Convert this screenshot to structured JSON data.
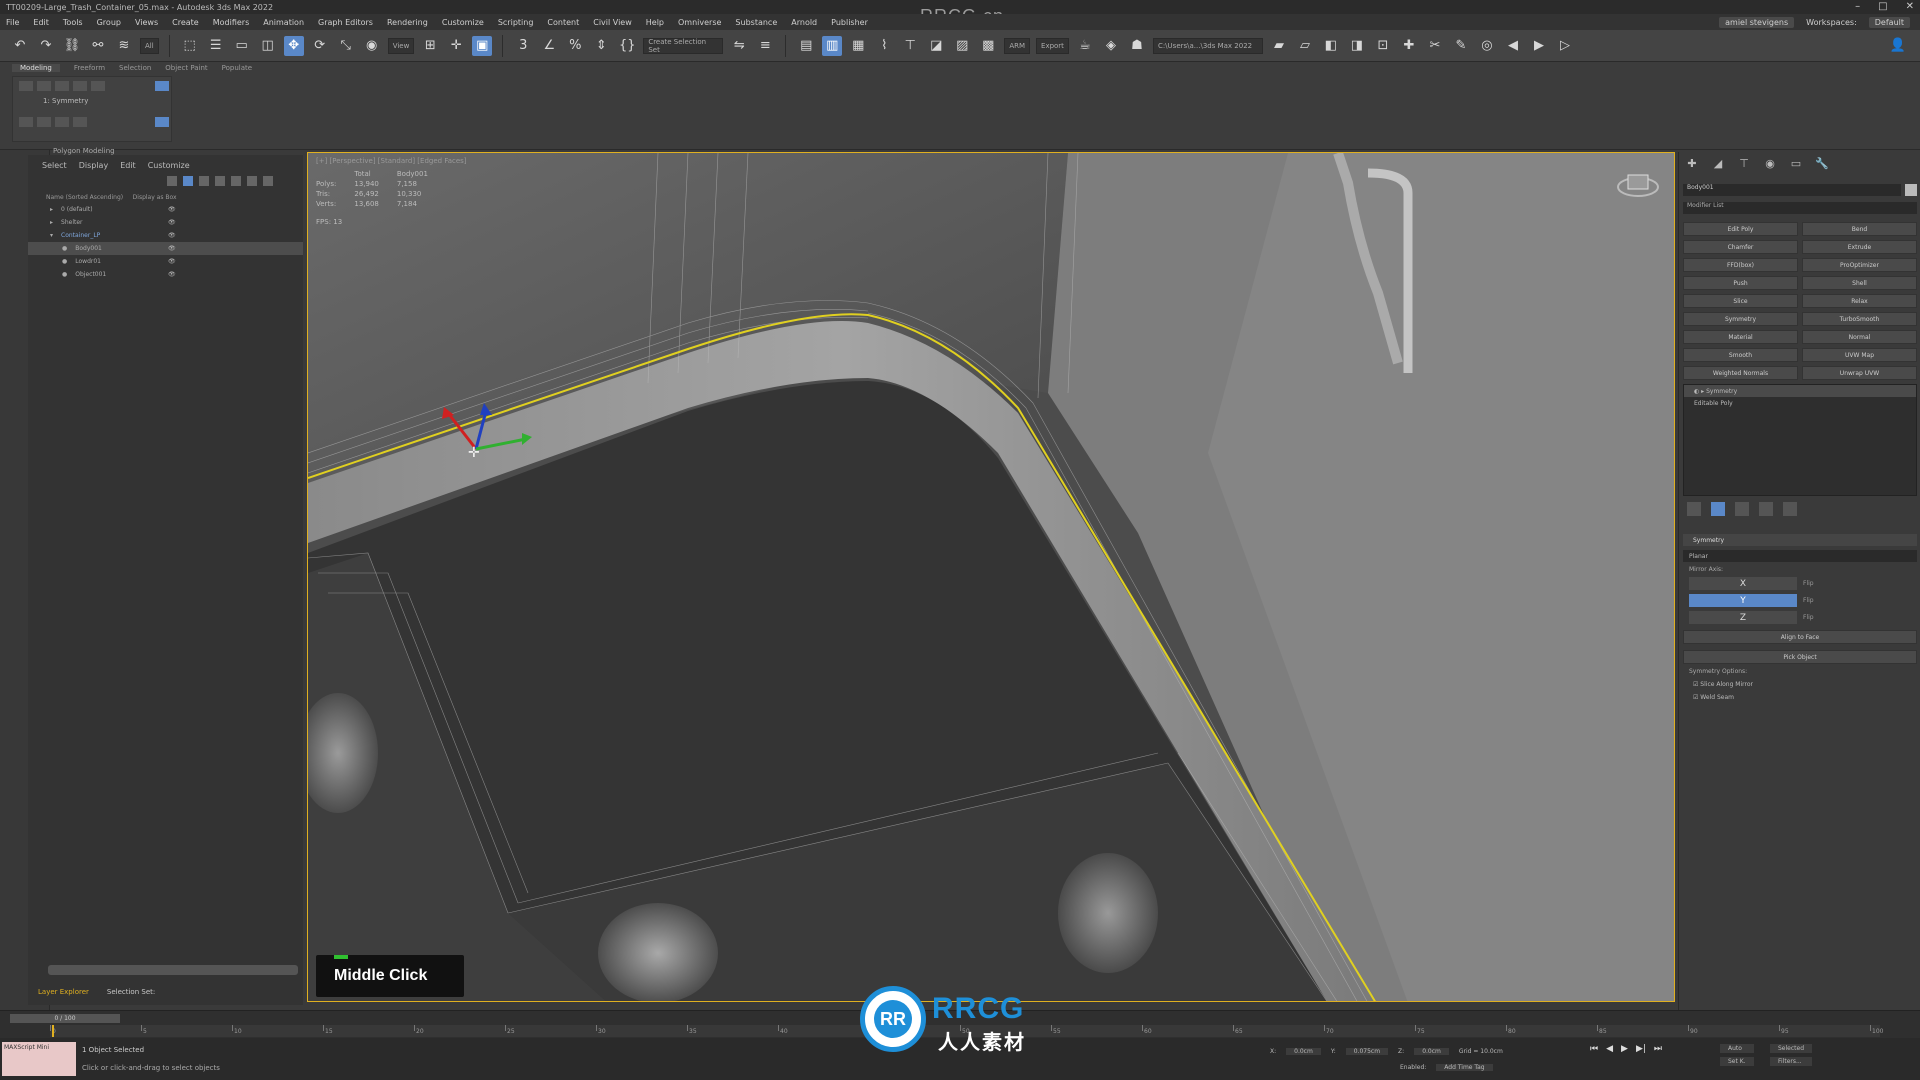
{
  "window": {
    "title": "TT00209-Large_Trash_Container_05.max - Autodesk 3ds Max 2022",
    "watermark": "RRCG.cn"
  },
  "menubar": {
    "items": [
      "File",
      "Edit",
      "Tools",
      "Group",
      "Views",
      "Create",
      "Modifiers",
      "Animation",
      "Graph Editors",
      "Rendering",
      "Customize",
      "Scripting",
      "Content",
      "Civil View",
      "Help",
      "Omniverse",
      "Substance",
      "Arnold",
      "Publisher"
    ],
    "account": "amiel stevigens",
    "workspace_label": "Workspaces:",
    "workspace": "Default"
  },
  "toolbar": {
    "selection_filter": "All",
    "view_dropdown": "View",
    "create_selection_set": "Create Selection Set",
    "project_path": "C:\\Users\\a...\\3ds Max 2022",
    "render_label": "ARM",
    "export_label": "Export"
  },
  "ribbon": {
    "tabs": [
      "Modeling",
      "Freeform",
      "Selection",
      "Object Paint",
      "Populate"
    ],
    "modifier": "1: Symmetry",
    "panel_label": "Polygon Modeling"
  },
  "explorer": {
    "menu": [
      "Select",
      "Display",
      "Edit",
      "Customize"
    ],
    "header_name": "Name (Sorted Ascending)",
    "header_display": "Display as Box",
    "rows": [
      {
        "name": "0 (default)",
        "selected": false,
        "blue": false
      },
      {
        "name": "Shelter",
        "selected": false,
        "blue": false
      },
      {
        "name": "Container_LP",
        "selected": false,
        "blue": true
      },
      {
        "name": "Body001",
        "selected": true,
        "blue": false
      },
      {
        "name": "Lowdr01",
        "selected": false,
        "blue": false
      },
      {
        "name": "Object001",
        "selected": false,
        "blue": false
      }
    ],
    "footer_left": "Layer Explorer",
    "footer_right": "Selection Set:"
  },
  "viewport": {
    "label": "[+] [Perspective] [Standard] [Edged Faces]",
    "stats": {
      "col_total": "Total",
      "col_object": "Body001",
      "polys_label": "Polys:",
      "polys_total": "13,940",
      "polys_obj": "7,158",
      "tris_label": "Tris:",
      "tris_total": "26,492",
      "tris_obj": "10,330",
      "verts_label": "Verts:",
      "verts_total": "13,608",
      "verts_obj": "7,184",
      "fps_label": "FPS:",
      "fps_value": "13"
    },
    "tooltip": "Middle Click"
  },
  "command_panel": {
    "object_name": "Body001",
    "modifier_list": "Modifier List",
    "buttons": [
      "Edit Poly",
      "Bend",
      "Chamfer",
      "Extrude",
      "FFD(box)",
      "ProOptimizer",
      "Push",
      "Shell",
      "Slice",
      "Relax",
      "Symmetry",
      "TurboSmooth",
      "Material",
      "Normal",
      "Smooth",
      "UVW Map",
      "Weighted Normals",
      "Unwrap UVW"
    ],
    "stack": [
      {
        "label": "Symmetry",
        "selected": true
      },
      {
        "label": "Editable Poly",
        "selected": false
      }
    ],
    "rollout_title": "Symmetry",
    "mode": "Planar",
    "mirror_axis_label": "Mirror Axis:",
    "axes": [
      {
        "name": "X",
        "active": false,
        "flip": "Flip"
      },
      {
        "name": "Y",
        "active": true,
        "flip": "Flip"
      },
      {
        "name": "Z",
        "active": false,
        "flip": "Flip"
      }
    ],
    "align_button": "Align to Face",
    "pick_button": "Pick Object",
    "options_label": "Symmetry Options:",
    "option_slice": "Slice Along Mirror",
    "option_weld": "Weld Seam"
  },
  "timeline": {
    "slider": "0 / 100",
    "ticks": [
      "0",
      "5",
      "10",
      "15",
      "20",
      "25",
      "30",
      "35",
      "40",
      "45",
      "50",
      "55",
      "60",
      "65",
      "70",
      "75",
      "80",
      "85",
      "90",
      "95",
      "100"
    ]
  },
  "statusbar": {
    "script_label": "MAXScript Mini",
    "selected": "1 Object Selected",
    "prompt": "Click or click-and-drag to select objects",
    "x_label": "X:",
    "x_val": "0.0cm",
    "y_label": "Y:",
    "y_val": "0.075cm",
    "z_label": "Z:",
    "z_val": "0.0cm",
    "grid": "Grid = 10.0cm",
    "enabled": "Enabled:",
    "add_time_tag": "Add Time Tag",
    "auto": "Auto",
    "set_key": "Set K.",
    "selected_drop": "Selected",
    "filters": "Filters..."
  },
  "logo": {
    "letters": "RR",
    "brand": "RRCG",
    "sub": "人人素材"
  },
  "colors": {
    "selection_highlight": "#e0b020",
    "accent_blue": "#5a88c8",
    "logo_blue": "#1e8fd8"
  }
}
